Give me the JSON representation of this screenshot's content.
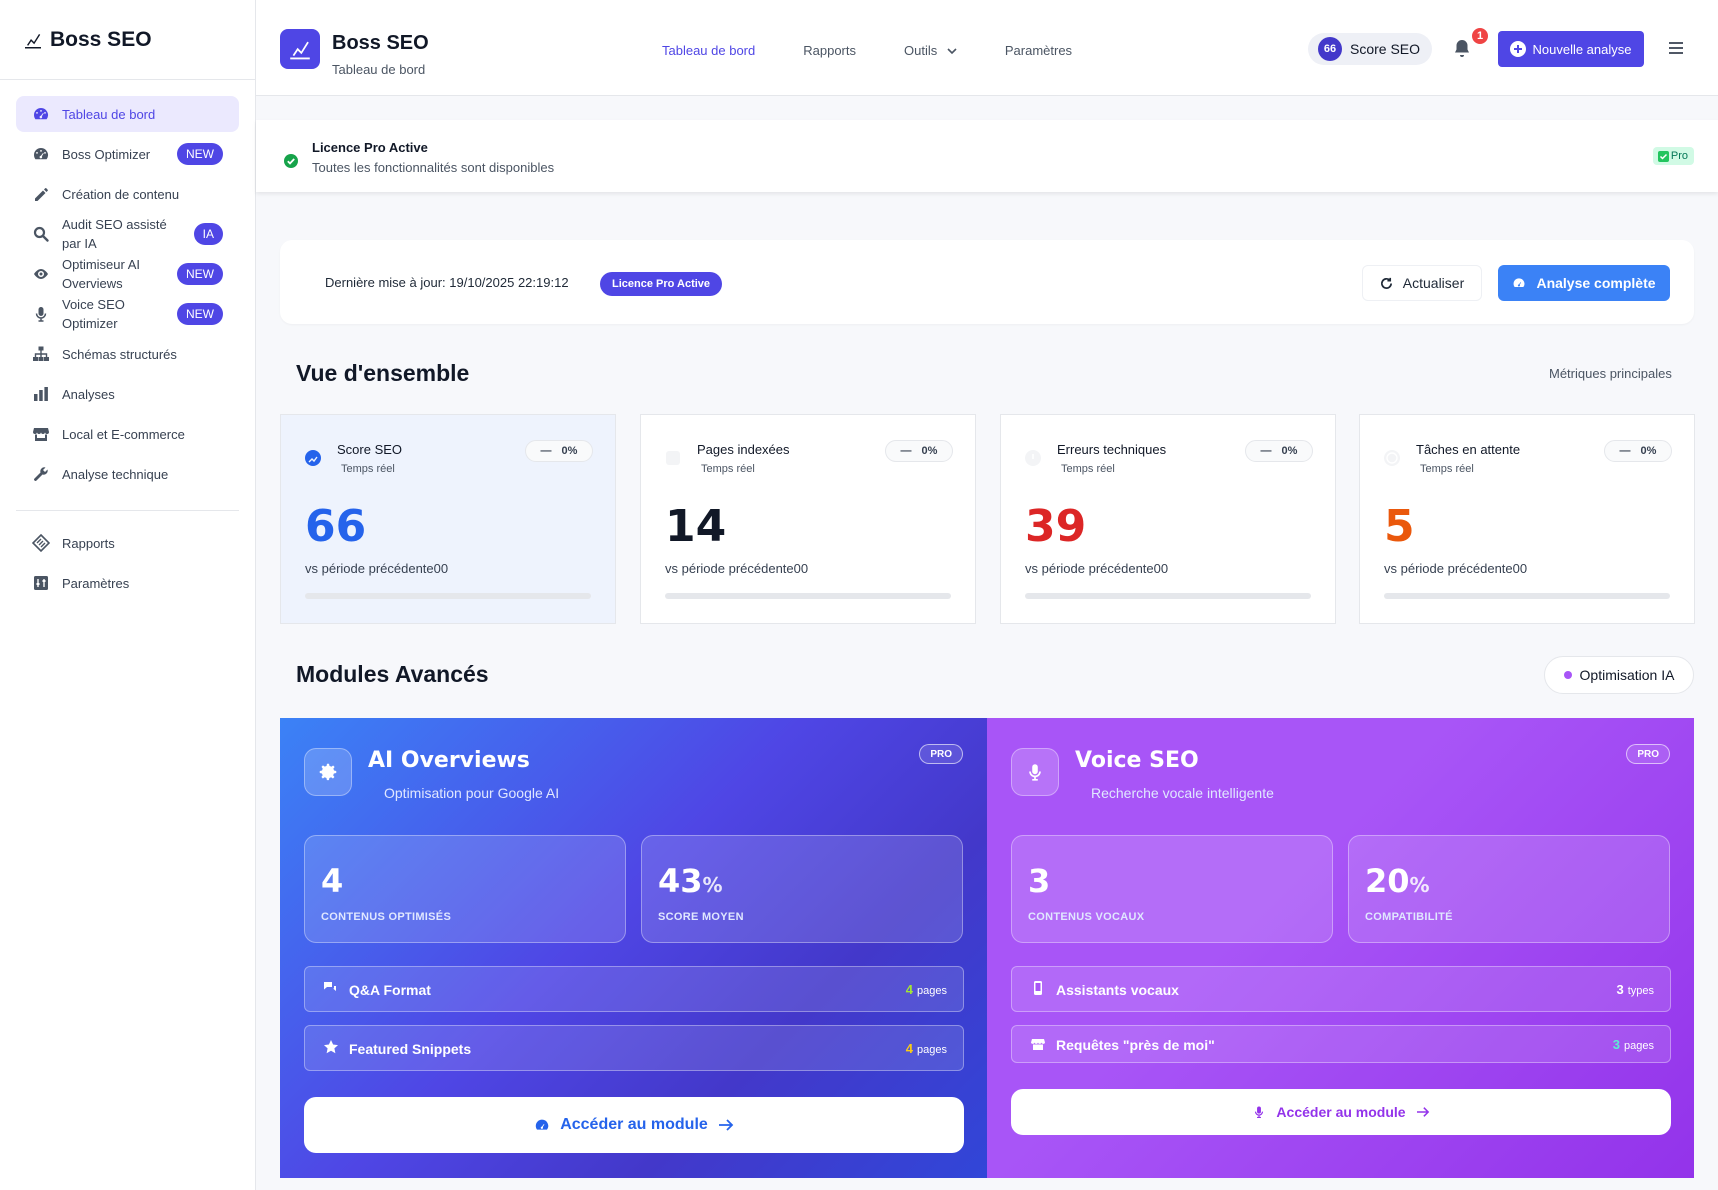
{
  "sidebar": {
    "brand": "Boss SEO",
    "items": [
      {
        "label": "Tableau de bord",
        "icon": "dashboard-icon"
      },
      {
        "label": "Boss Optimizer",
        "badge": "NEW",
        "icon": "gauge-icon"
      },
      {
        "label": "Création de contenu",
        "icon": "pencil-icon"
      },
      {
        "label": "Audit SEO assisté par IA",
        "badge": "IA",
        "icon": "search-icon"
      },
      {
        "label": "Optimiseur AI Overviews",
        "badge": "NEW",
        "icon": "eye-icon"
      },
      {
        "label": "Voice SEO Optimizer",
        "badge": "NEW",
        "icon": "microphone-icon"
      },
      {
        "label": "Schémas structurés",
        "icon": "sitemap-icon"
      },
      {
        "label": "Analyses",
        "icon": "bar-chart-icon"
      },
      {
        "label": "Local et E-commerce",
        "icon": "store-icon"
      },
      {
        "label": "Analyse technique",
        "icon": "wrench-icon"
      }
    ],
    "bottom_items": [
      {
        "label": "Rapports",
        "icon": "report-icon"
      },
      {
        "label": "Paramètres",
        "icon": "settings-icon"
      }
    ]
  },
  "header": {
    "title": "Boss SEO",
    "subtitle": "Tableau de bord",
    "nav": [
      "Tableau de bord",
      "Rapports",
      "Outils",
      "Paramètres"
    ],
    "score_value": "66",
    "score_label": "Score SEO",
    "notification_count": "1",
    "new_button": "Nouvelle analyse"
  },
  "license": {
    "title": "Licence Pro Active",
    "subtitle": "Toutes les fonctionnalités sont disponibles",
    "badge": "Pro"
  },
  "update_bar": {
    "text": "Dernière mise à jour: 19/10/2025 22:19:12",
    "badge": "Licence Pro Active",
    "refresh": "Actualiser",
    "full_analysis": "Analyse complète"
  },
  "overview": {
    "title": "Vue d'ensemble",
    "label": "Métriques principales",
    "kpis": [
      {
        "title": "Score SEO",
        "sub": "Temps réel",
        "change": "0%",
        "value": "66",
        "vs": "vs période précédente00",
        "color": "#2563eb",
        "progress": 0
      },
      {
        "title": "Pages indexées",
        "sub": "Temps réel",
        "change": "0%",
        "value": "14",
        "vs": "vs période précédente00",
        "color": "#111827",
        "progress": 0
      },
      {
        "title": "Erreurs techniques",
        "sub": "Temps réel",
        "change": "0%",
        "value": "39",
        "vs": "vs période précédente00",
        "color": "#dc2626",
        "progress": 0
      },
      {
        "title": "Tâches en attente",
        "sub": "Temps réel",
        "change": "0%",
        "value": "5",
        "vs": "vs période précédente00",
        "color": "#ea580c",
        "progress": 0
      }
    ]
  },
  "modules": {
    "title": "Modules Avancés",
    "chip": "Optimisation IA",
    "ai": {
      "title": "AI Overviews",
      "subtitle": "Optimisation pour Google AI",
      "badge": "PRO",
      "stats": [
        {
          "value": "4",
          "suffix": "",
          "label": "CONTENUS OPTIMISÉS"
        },
        {
          "value": "43",
          "suffix": "%",
          "label": "SCORE MOYEN"
        }
      ],
      "rows": [
        {
          "label": "Q&A Format",
          "count": "4",
          "unit": "pages"
        },
        {
          "label": "Featured Snippets",
          "count": "4",
          "unit": "pages"
        }
      ],
      "access": "Accéder au module"
    },
    "voice": {
      "title": "Voice SEO",
      "subtitle": "Recherche vocale intelligente",
      "badge": "PRO",
      "stats": [
        {
          "value": "3",
          "suffix": "",
          "label": "CONTENUS VOCAUX"
        },
        {
          "value": "20",
          "suffix": "%",
          "label": "COMPATIBILITÉ"
        }
      ],
      "rows": [
        {
          "label": "Assistants vocaux",
          "count": "3",
          "unit": "types"
        },
        {
          "label": "Requêtes \"près de moi\"",
          "count": "3",
          "unit": "pages"
        }
      ],
      "access": "Accéder au module"
    }
  },
  "colors": {
    "accent": "#4f46e5",
    "blue": "#3b82f6",
    "purple": "#a855f7"
  }
}
